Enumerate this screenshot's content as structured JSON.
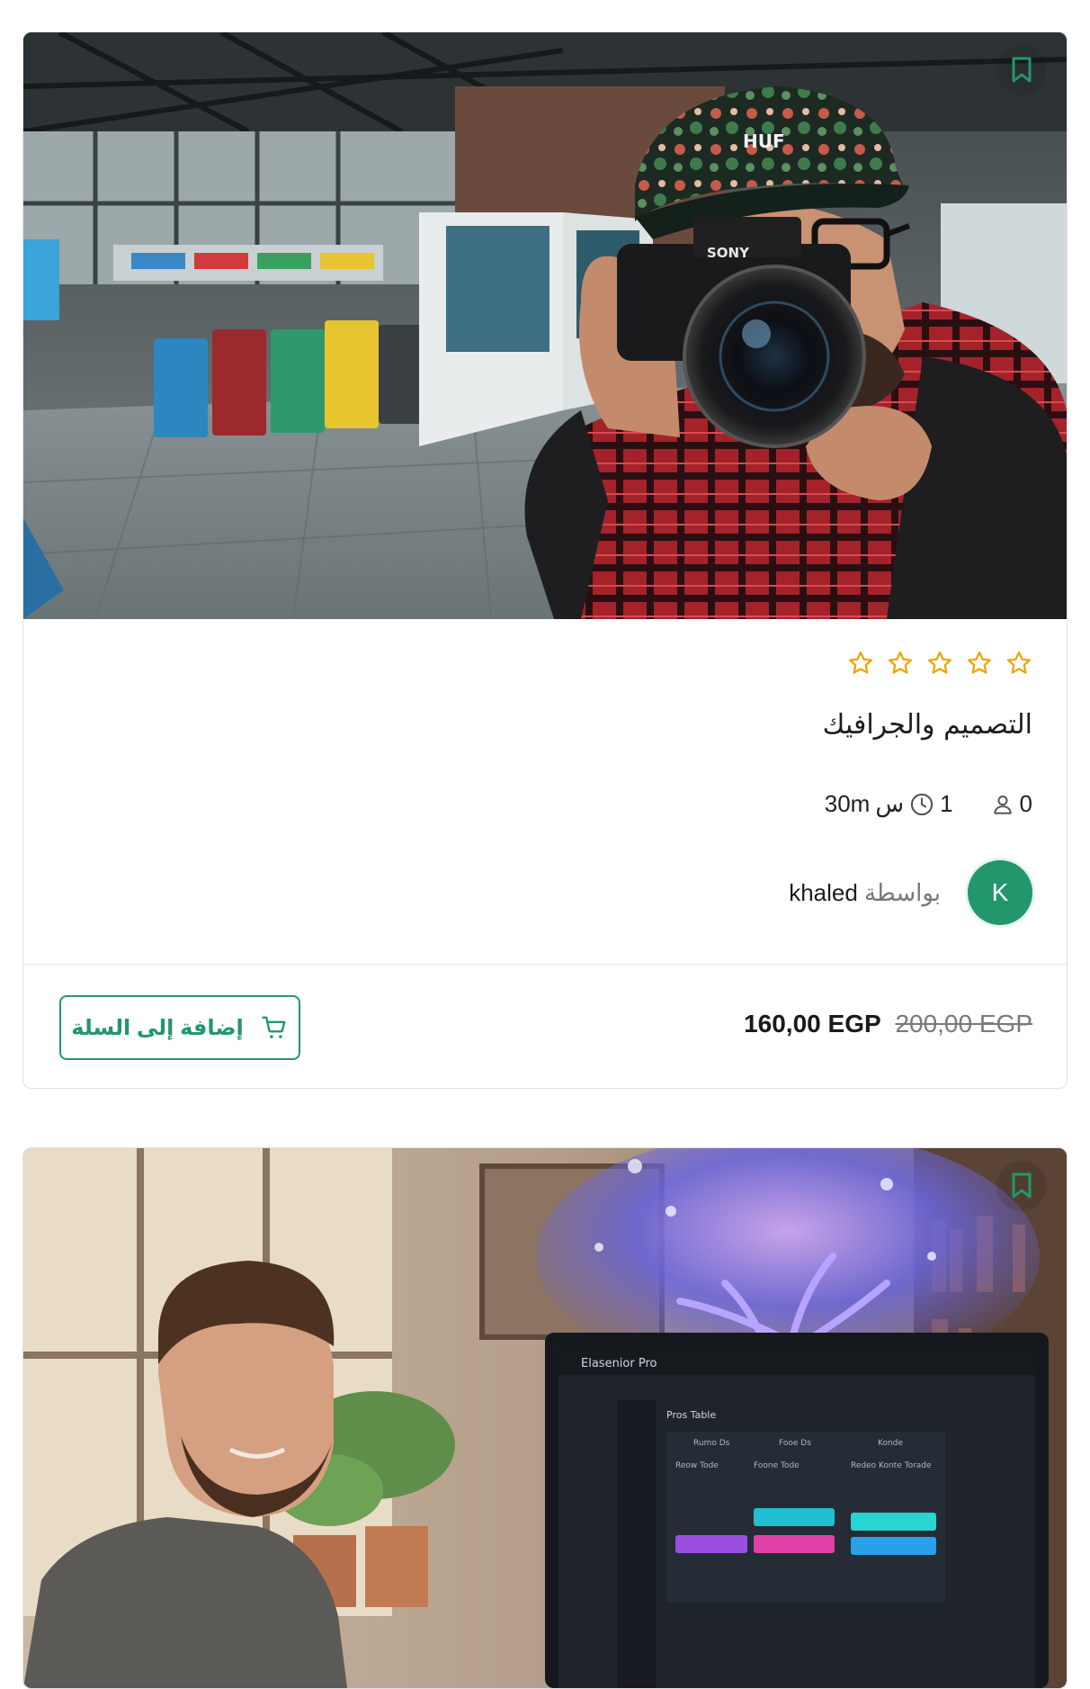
{
  "colors": {
    "accent": "#23976c",
    "star": "#f0a500"
  },
  "courses": [
    {
      "title": "التصميم والجرافيك",
      "rating_stars": 5,
      "rating_value": 0,
      "students": "0",
      "duration_hours": "1",
      "duration_hours_unit": "س",
      "duration_minutes": "30m",
      "author_prefix": "بواسطة",
      "author_name": "khaled",
      "author_initial": "K",
      "price_new": "160,00 EGP",
      "price_old": "200,00 EGP",
      "cart_label": "إضافة إلى السلة",
      "image": "photographer-with-camera",
      "bookmark_icon": "bookmark-icon"
    },
    {
      "image": "man-with-glowing-tree-monitor",
      "bookmark_icon": "bookmark-icon",
      "monitor_text": {
        "brand": "Elasenior Pro",
        "heading": "Pros Table",
        "col1": "Rumo Ds",
        "col2": "Fooe Ds",
        "col3": "Konde",
        "row1": "Reow Tode",
        "row2": "Foone Tode",
        "row3": "Redeo Konte Torade"
      }
    }
  ]
}
